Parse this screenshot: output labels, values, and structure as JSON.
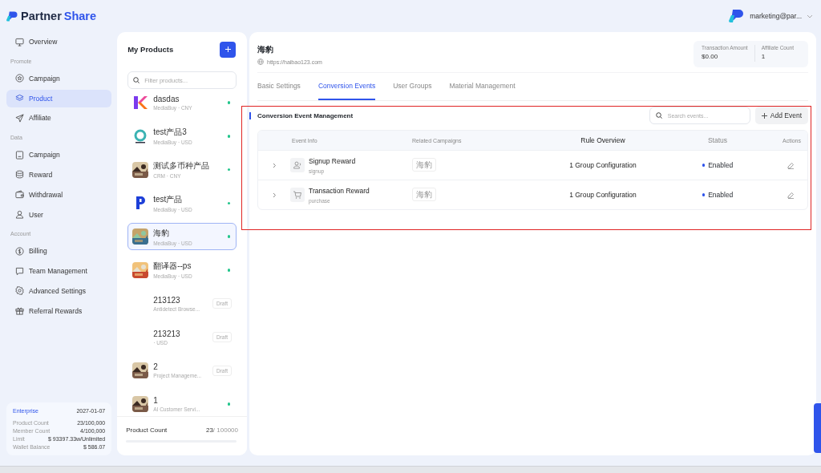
{
  "topbar": {
    "brand": [
      "Partner",
      "Share"
    ],
    "account": "marketing@par..."
  },
  "sidebar": {
    "sections": [
      {
        "items": [
          {
            "label": "Overview",
            "selected": false
          }
        ]
      },
      {
        "heading": "Promote",
        "items": [
          {
            "label": "Campaign",
            "selected": false
          },
          {
            "label": "Product",
            "selected": true
          },
          {
            "label": "Affiliate",
            "selected": false
          }
        ]
      },
      {
        "heading": "Data",
        "items": [
          {
            "label": "Campaign",
            "selected": false
          },
          {
            "label": "Reward",
            "selected": false
          },
          {
            "label": "Withdrawal",
            "selected": false
          },
          {
            "label": "User",
            "selected": false
          }
        ]
      },
      {
        "heading": "Account",
        "items": [
          {
            "label": "Billing",
            "selected": false
          },
          {
            "label": "Team Management",
            "selected": false
          },
          {
            "label": "Advanced Settings",
            "selected": false
          },
          {
            "label": "Referral Rewards",
            "selected": false
          }
        ]
      }
    ],
    "plan": {
      "name": "Enterprise",
      "expires": "2027-01-07",
      "rows": [
        {
          "label": "Product Count",
          "value": "23/100,000"
        },
        {
          "label": "Member Count",
          "value": "4/100,000"
        },
        {
          "label": "Limit",
          "value": "$ 93397.33w/Unlimited"
        },
        {
          "label": "Wallet Balance",
          "value": "$ 586.07"
        }
      ]
    }
  },
  "products": {
    "title": "My Products",
    "filter_placeholder": "Filter products...",
    "items": [
      {
        "name": "dasdas",
        "subtitle": "MediaBuy · CNY",
        "online": true,
        "selected": false
      },
      {
        "name": "test产品3",
        "subtitle": "MediaBuy · USD",
        "online": true,
        "selected": false
      },
      {
        "name": "测试多币种产品",
        "subtitle": "CRM · CNY",
        "online": true,
        "selected": false
      },
      {
        "name": "test产品",
        "subtitle": "MediaBuy · USD",
        "online": true,
        "selected": false
      },
      {
        "name": "海豹",
        "subtitle": "MediaBuy · USD",
        "online": true,
        "selected": true
      },
      {
        "name": "翻译器--ps",
        "subtitle": "MediaBuy · USD",
        "online": true,
        "selected": false
      },
      {
        "name": "213123",
        "subtitle": "Antidetect Browse...",
        "online": false,
        "badge": "Draft",
        "selected": false
      },
      {
        "name": "213213",
        "subtitle": "· USD",
        "online": false,
        "badge": "Draft",
        "selected": false
      },
      {
        "name": "2",
        "subtitle": "Project Manageme...",
        "online": false,
        "badge": "Draft",
        "selected": false
      },
      {
        "name": "1",
        "subtitle": "AI Customer Servi...",
        "online": true,
        "selected": false
      }
    ],
    "footer": {
      "label": "Product Count",
      "used": "23",
      "total": "/ 100000",
      "level": 0.0002
    }
  },
  "detail": {
    "title": "海豹",
    "url": "https://haibao123.com",
    "stats": [
      {
        "label": "Transaction Amount",
        "value": "$0.00"
      },
      {
        "label": "Affiliate Count",
        "value": "1"
      }
    ],
    "tabs": [
      {
        "label": "Basic Settings",
        "selected": false
      },
      {
        "label": "Conversion Events",
        "selected": true
      },
      {
        "label": "User Groups",
        "selected": false
      },
      {
        "label": "Material Management",
        "selected": false
      }
    ],
    "section": {
      "title": "Conversion Event Management",
      "search_placeholder": "Search events...",
      "add_button": "Add Event"
    },
    "table": {
      "columns": [
        "Event Info",
        "Related Campaigns",
        "Rule Overview",
        "Status",
        "Actions"
      ],
      "rows": [
        {
          "name": "Signup Reward",
          "code": "signup",
          "kind": "user",
          "campaign": "海豹",
          "rule": "1 Group Configuration",
          "status": "Enabled",
          "enabled": true
        },
        {
          "name": "Transaction Reward",
          "code": "purchase",
          "kind": "cart",
          "campaign": "海豹",
          "rule": "1 Group Configuration",
          "status": "Enabled",
          "enabled": true
        }
      ]
    }
  }
}
